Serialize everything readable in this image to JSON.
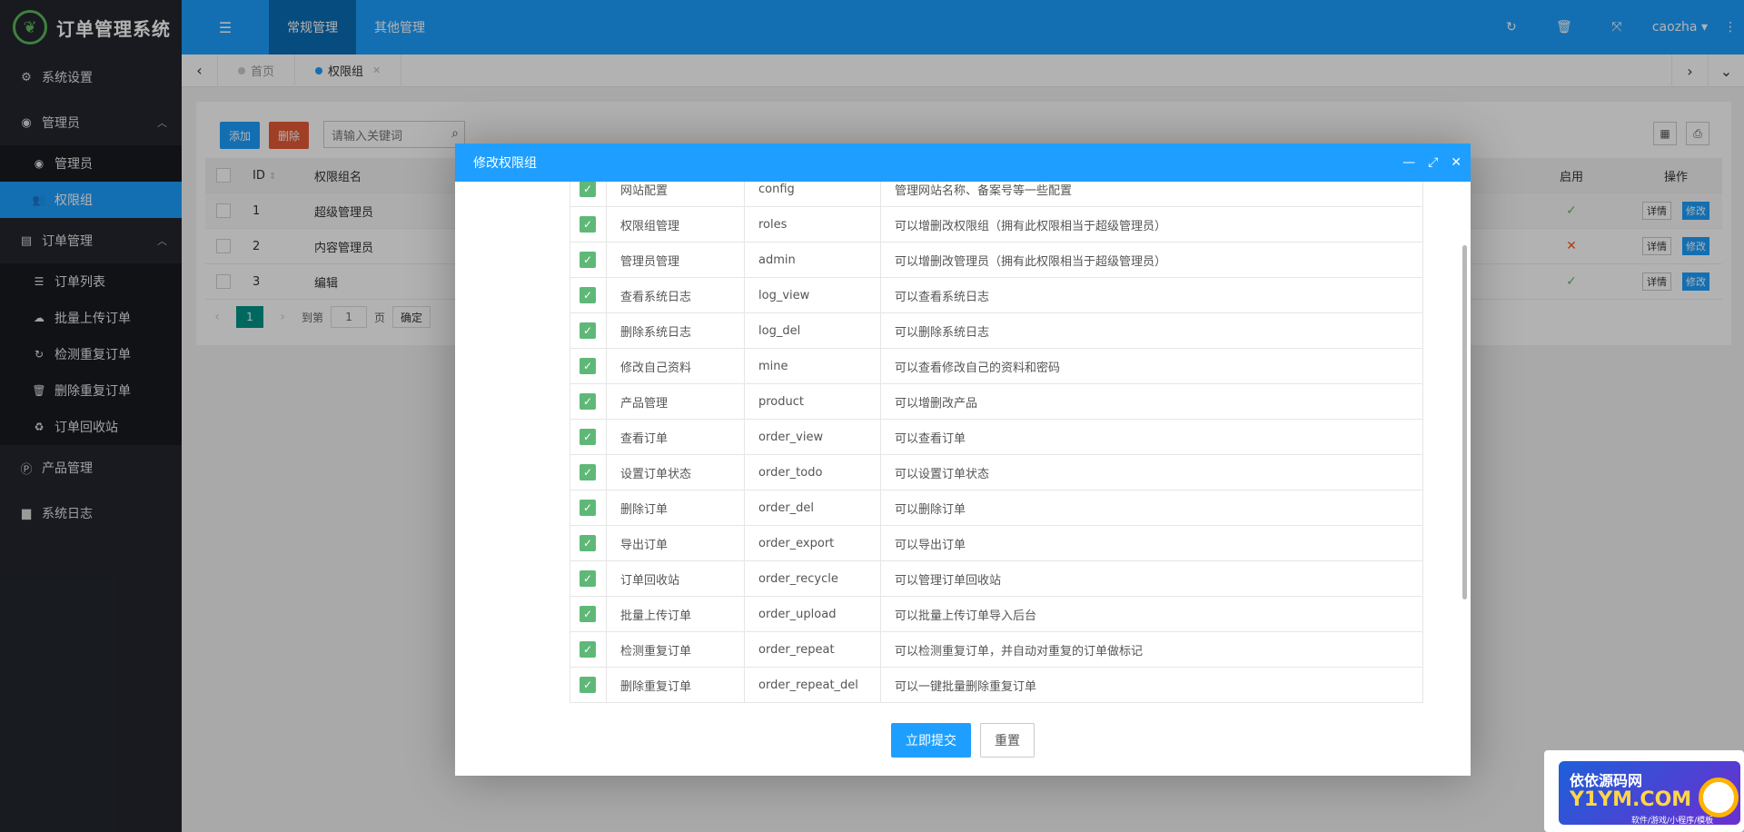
{
  "app": {
    "title": "订单管理系统"
  },
  "header": {
    "tabs": [
      "常规管理",
      "其他管理"
    ],
    "user": "caozha"
  },
  "sidebar": {
    "items": [
      {
        "label": "系统设置",
        "icon": "gears-icon"
      },
      {
        "label": "管理员",
        "icon": "user-circle-icon"
      },
      {
        "label": "订单管理",
        "icon": "list-icon"
      },
      {
        "label": "产品管理",
        "icon": "product-icon"
      },
      {
        "label": "系统日志",
        "icon": "file-icon"
      }
    ],
    "admin_sub": [
      {
        "label": "管理员",
        "icon": "user-circle-icon"
      },
      {
        "label": "权限组",
        "icon": "group-icon"
      }
    ],
    "order_sub": [
      {
        "label": "订单列表",
        "icon": "list-icon"
      },
      {
        "label": "批量上传订单",
        "icon": "upload-icon"
      },
      {
        "label": "检测重复订单",
        "icon": "refresh-icon"
      },
      {
        "label": "删除重复订单",
        "icon": "trash-icon"
      },
      {
        "label": "订单回收站",
        "icon": "recycle-icon"
      }
    ]
  },
  "tabstrip": {
    "tabs": [
      "首页",
      "权限组"
    ]
  },
  "panel": {
    "add_label": "添加",
    "delete_label": "删除",
    "search_placeholder": "请输入关键词",
    "columns": {
      "id": "ID",
      "name": "权限组名",
      "enabled": "启用",
      "ops": "操作"
    },
    "rows": [
      {
        "id": "1",
        "name": "超级管理员",
        "enabled": true
      },
      {
        "id": "2",
        "name": "内容管理员",
        "enabled": false
      },
      {
        "id": "3",
        "name": "编辑",
        "enabled": true
      }
    ],
    "detail_label": "详情",
    "edit_label": "修改",
    "pager": {
      "current": "1",
      "goto_label": "到第",
      "page_value": "1",
      "page_label": "页",
      "confirm_label": "确定"
    }
  },
  "modal": {
    "title": "修改权限组",
    "submit_label": "立即提交",
    "reset_label": "重置",
    "permissions": [
      {
        "name": "网站配置",
        "code": "config",
        "desc": "管理网站名称、备案号等一些配置"
      },
      {
        "name": "权限组管理",
        "code": "roles",
        "desc": "可以增删改权限组（拥有此权限相当于超级管理员）"
      },
      {
        "name": "管理员管理",
        "code": "admin",
        "desc": "可以增删改管理员（拥有此权限相当于超级管理员）"
      },
      {
        "name": "查看系统日志",
        "code": "log_view",
        "desc": "可以查看系统日志"
      },
      {
        "name": "删除系统日志",
        "code": "log_del",
        "desc": "可以删除系统日志"
      },
      {
        "name": "修改自己资料",
        "code": "mine",
        "desc": "可以查看修改自己的资料和密码"
      },
      {
        "name": "产品管理",
        "code": "product",
        "desc": "可以增删改产品"
      },
      {
        "name": "查看订单",
        "code": "order_view",
        "desc": "可以查看订单"
      },
      {
        "name": "设置订单状态",
        "code": "order_todo",
        "desc": "可以设置订单状态"
      },
      {
        "name": "删除订单",
        "code": "order_del",
        "desc": "可以删除订单"
      },
      {
        "name": "导出订单",
        "code": "order_export",
        "desc": "可以导出订单"
      },
      {
        "name": "订单回收站",
        "code": "order_recycle",
        "desc": "可以管理订单回收站"
      },
      {
        "name": "批量上传订单",
        "code": "order_upload",
        "desc": "可以批量上传订单导入后台"
      },
      {
        "name": "检测重复订单",
        "code": "order_repeat",
        "desc": "可以检测重复订单，并自动对重复的订单做标记"
      },
      {
        "name": "删除重复订单",
        "code": "order_repeat_del",
        "desc": "可以一键批量删除重复订单"
      }
    ]
  },
  "watermark": {
    "line1": "依依源码网",
    "line2": "Y1YM.COM",
    "line3": "软件/游戏/小程序/模板"
  }
}
